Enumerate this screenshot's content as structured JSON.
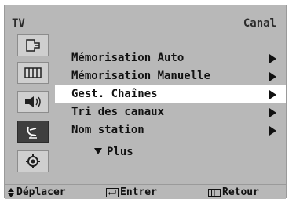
{
  "header": {
    "left_label": "TV",
    "right_label": "Canal"
  },
  "sidebar": {
    "items": [
      {
        "icon": "input-icon",
        "active": false
      },
      {
        "icon": "picture-icon",
        "active": false
      },
      {
        "icon": "sound-icon",
        "active": false
      },
      {
        "icon": "channel-icon",
        "active": true
      },
      {
        "icon": "setup-icon",
        "active": false
      }
    ]
  },
  "menu": {
    "items": [
      {
        "label": "Mémorisation Auto",
        "selected": false
      },
      {
        "label": "Mémorisation Manuelle",
        "selected": false
      },
      {
        "label": "Gest. Chaînes",
        "selected": true
      },
      {
        "label": "Tri des canaux",
        "selected": false
      },
      {
        "label": "Nom station",
        "selected": false
      }
    ],
    "more_label": "Plus"
  },
  "footer": {
    "move_label": "Déplacer",
    "enter_label": "Entrer",
    "return_label": "Retour"
  },
  "colors": {
    "frame_gray": "#b8b8b8",
    "highlight": "#ffffff",
    "active_icon_bg": "#3f3f3f",
    "text": "#111111"
  }
}
